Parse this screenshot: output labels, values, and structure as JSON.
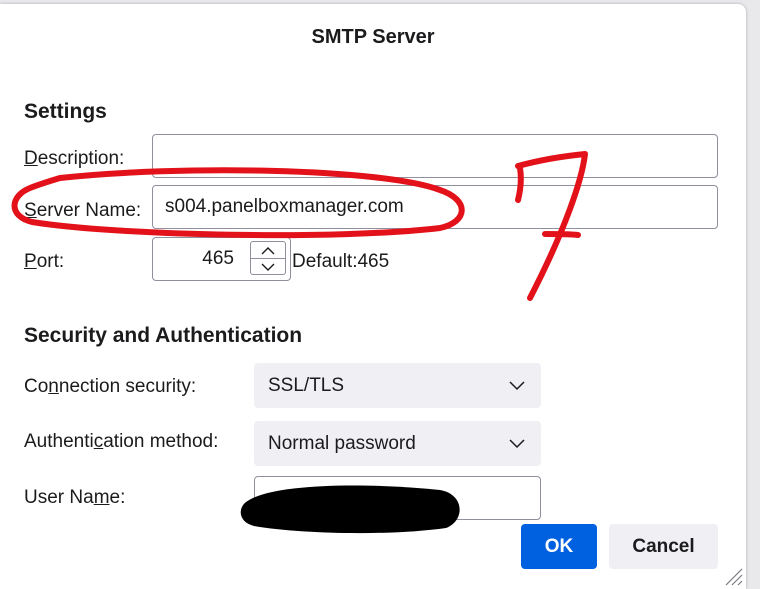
{
  "dialog": {
    "title": "SMTP Server"
  },
  "settings": {
    "heading": "Settings",
    "description": {
      "label_pre": "",
      "label_key": "D",
      "label_post": "escription:",
      "value": ""
    },
    "server_name": {
      "label_pre": "",
      "label_key": "S",
      "label_post": "erver Name:",
      "value": "s004.panelboxmanager.com"
    },
    "port": {
      "label_pre": "",
      "label_key": "P",
      "label_post": "ort:",
      "value": "465",
      "default_text": "Default:465"
    }
  },
  "security": {
    "heading": "Security and Authentication",
    "connection": {
      "label_pre": "Co",
      "label_key": "n",
      "label_post": "nection security:",
      "value": "SSL/TLS"
    },
    "auth": {
      "label_pre": "Authenti",
      "label_key": "c",
      "label_post": "ation method:",
      "value": "Normal password"
    },
    "user": {
      "label_pre": "User Na",
      "label_key": "m",
      "label_post": "e:",
      "value": ""
    }
  },
  "buttons": {
    "ok": "OK",
    "cancel": "Cancel"
  },
  "annotation": {
    "text": "7",
    "color": "#e3121a"
  },
  "colors": {
    "accent": "#0061e0",
    "button_bg": "#f0f0f4"
  }
}
